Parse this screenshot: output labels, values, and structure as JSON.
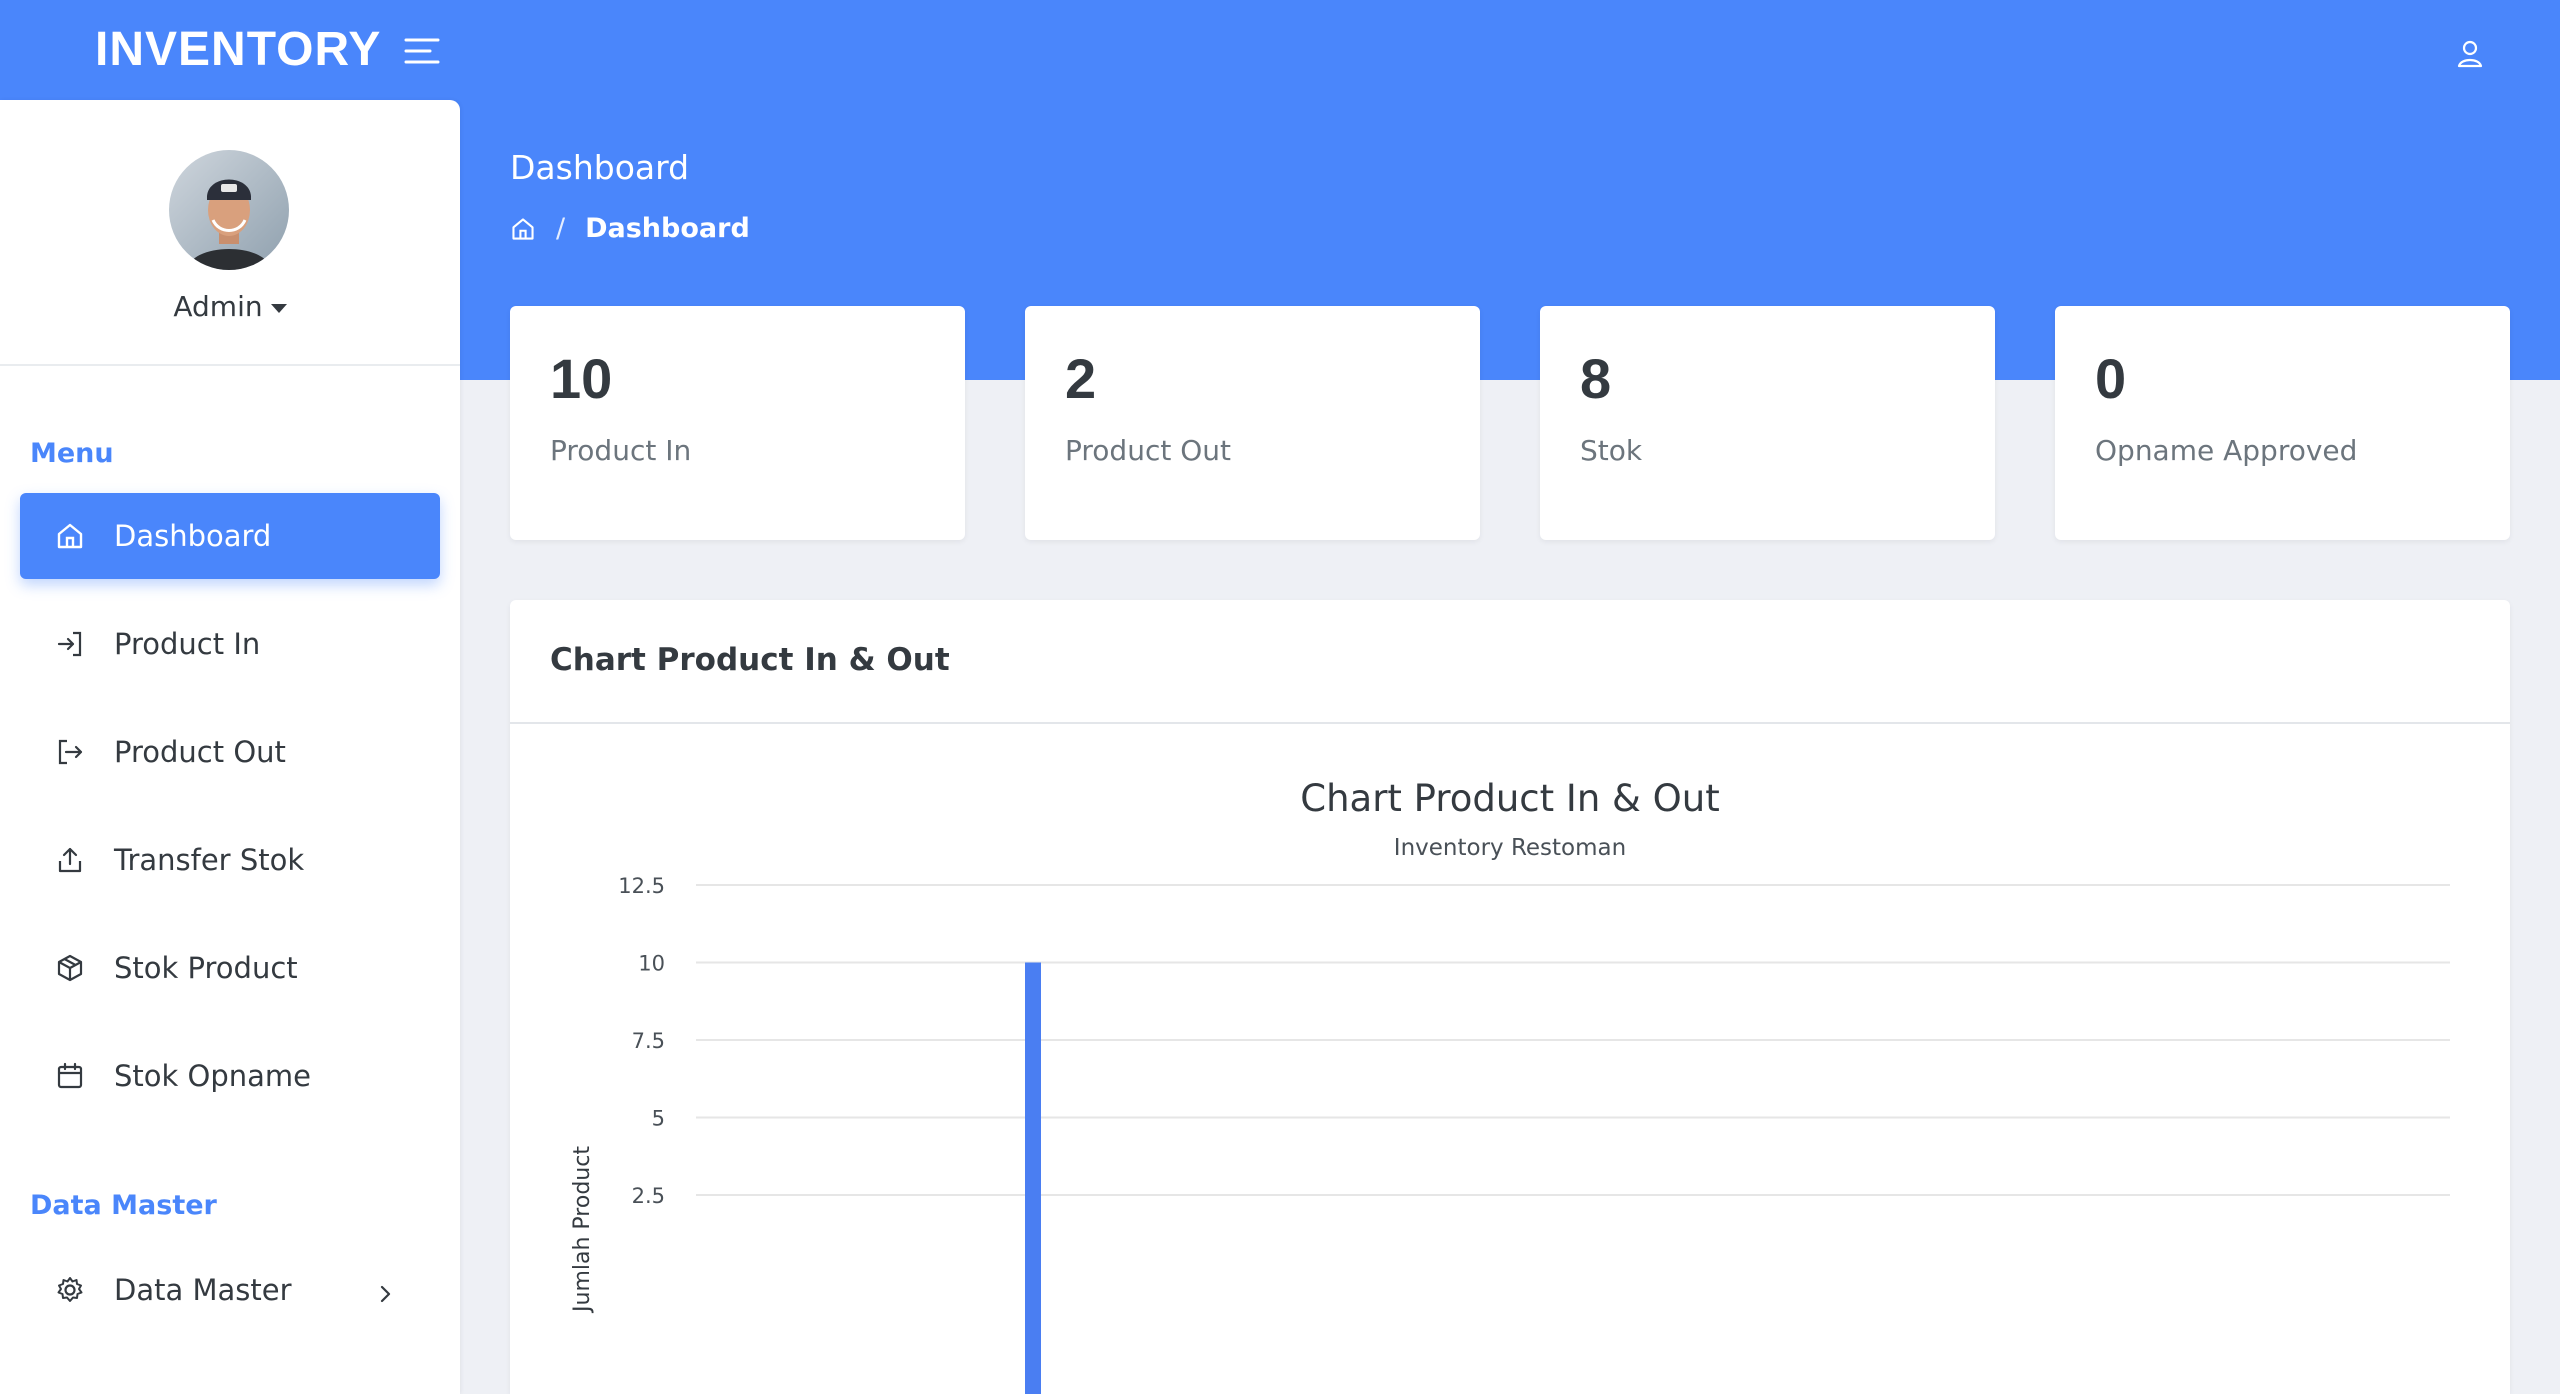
{
  "app": {
    "brand": "INVENTORY"
  },
  "user": {
    "name": "Admin"
  },
  "sidebar": {
    "menu_heading": "Menu",
    "items": [
      {
        "label": "Dashboard",
        "icon": "home-icon",
        "active": true
      },
      {
        "label": "Product In",
        "icon": "login-icon"
      },
      {
        "label": "Product Out",
        "icon": "logout-icon"
      },
      {
        "label": "Transfer Stok",
        "icon": "upload-icon"
      },
      {
        "label": "Stok Product",
        "icon": "box-icon"
      },
      {
        "label": "Stok Opname",
        "icon": "calendar-icon"
      }
    ],
    "master_heading": "Data Master",
    "master_items": [
      {
        "label": "Data Master",
        "icon": "gear-icon"
      }
    ]
  },
  "header": {
    "title": "Dashboard",
    "breadcrumb": {
      "separator": "/",
      "current": "Dashboard"
    }
  },
  "stats": [
    {
      "value": "10",
      "label": "Product In"
    },
    {
      "value": "2",
      "label": "Product Out"
    },
    {
      "value": "8",
      "label": "Stok"
    },
    {
      "value": "0",
      "label": "Opname Approved"
    }
  ],
  "chart_panel": {
    "title": "Chart Product In & Out"
  },
  "chart_data": {
    "type": "bar",
    "title": "Chart Product In & Out",
    "subtitle": "Inventory Restoman",
    "ylabel": "Jumlah Product",
    "xlabel": "",
    "ylim": [
      0,
      12.5
    ],
    "y_ticks": [
      "12.5",
      "10",
      "7.5",
      "5",
      "2.5"
    ],
    "y_tick_values": [
      12.5,
      10,
      7.5,
      5,
      2.5
    ],
    "grid": true,
    "series": [
      {
        "values": [
          10
        ],
        "color": "#4a7ef2"
      }
    ]
  },
  "colors": {
    "primary": "#4a86fb",
    "bar": "#4a7ef2"
  }
}
